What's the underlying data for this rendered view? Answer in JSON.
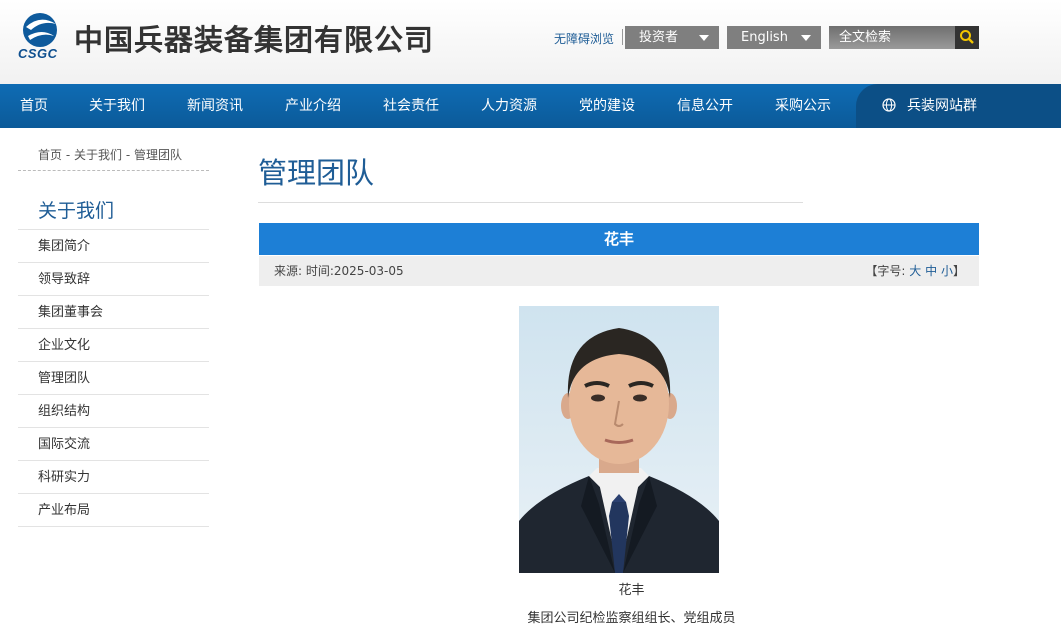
{
  "header": {
    "logo_text": "CSGC",
    "company_name": "中国兵器装备集团有限公司",
    "accessibility_link": "无障碍浏览",
    "investor_dropdown": "投资者",
    "language_dropdown": "English",
    "search_placeholder": "全文检索"
  },
  "nav": {
    "items": [
      "首页",
      "关于我们",
      "新闻资讯",
      "产业介绍",
      "社会责任",
      "人力资源",
      "党的建设",
      "信息公开",
      "采购公示"
    ],
    "site_group": "兵装网站群"
  },
  "breadcrumb": {
    "home": "首页",
    "sep1": " - ",
    "section": "关于我们",
    "sep2": " - ",
    "current": "管理团队"
  },
  "sidebar": {
    "title": "关于我们",
    "items": [
      "集团简介",
      "领导致辞",
      "集团董事会",
      "企业文化",
      "管理团队",
      "组织结构",
      "国际交流",
      "科研实力",
      "产业布局"
    ]
  },
  "main": {
    "page_title": "管理团队",
    "article_title": "花丰",
    "meta_source": "来源:  时间:2025-03-05",
    "font_size": {
      "open": "【字号: ",
      "large": "大",
      "medium": "中",
      "small": "小",
      "close": "】"
    },
    "photo_caption_name": "花丰",
    "photo_caption_title": "集团公司纪检监察组组长、党组成员"
  },
  "colors": {
    "brand_blue": "#0f6cb4",
    "title_bar": "#1d7fd6",
    "link": "#1f5d96"
  }
}
